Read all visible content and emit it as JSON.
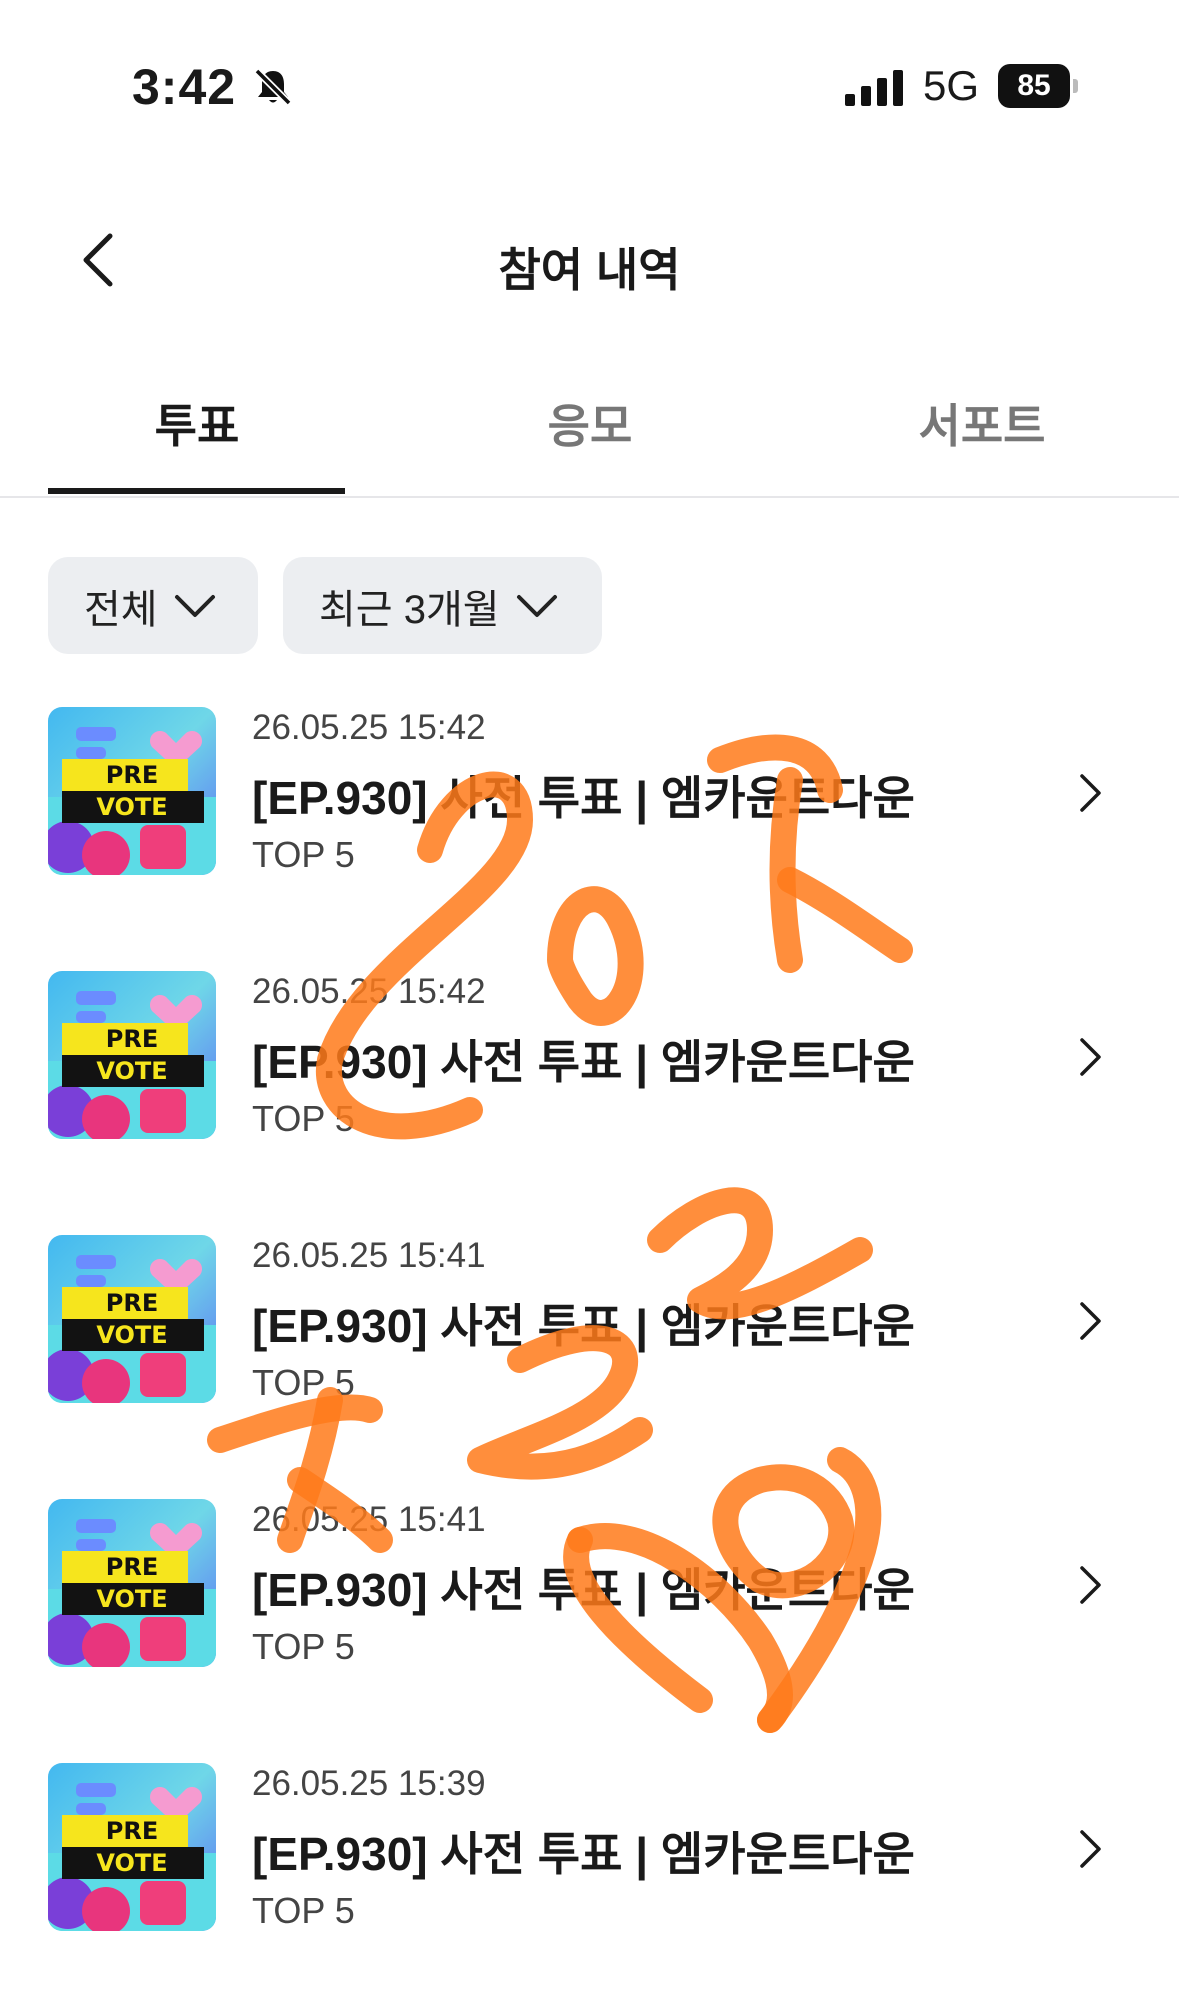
{
  "status_bar": {
    "time": "3:42",
    "network": "5G",
    "battery": "85"
  },
  "nav": {
    "title": "참여 내역"
  },
  "tabs": [
    {
      "label": "투표",
      "active": true
    },
    {
      "label": "응모",
      "active": false
    },
    {
      "label": "서포트",
      "active": false
    }
  ],
  "filters": {
    "category": "전체",
    "period": "최근 3개월"
  },
  "thumbnail": {
    "line1": "PRE",
    "line2": "VOTE"
  },
  "items": [
    {
      "date": "26.05.25 15:42",
      "title": "[EP.930] 사전 투표 | 엠카운트다운",
      "subtitle": "TOP 5"
    },
    {
      "date": "26.05.25 15:42",
      "title": "[EP.930] 사전 투표 | 엠카운트다운",
      "subtitle": "TOP 5"
    },
    {
      "date": "26.05.25 15:41",
      "title": "[EP.930] 사전 투표 | 엠카운트다운",
      "subtitle": "TOP 5"
    },
    {
      "date": "26.05.25 15:41",
      "title": "[EP.930] 사전 투표 | 엠카운트다운",
      "subtitle": "TOP 5"
    },
    {
      "date": "26.05.25 15:39",
      "title": "[EP.930] 사전 투표 | 엠카운트다운",
      "subtitle": "TOP 5"
    }
  ],
  "colors": {
    "scribble": "#ff7a1a",
    "chip_bg": "#eceef1"
  }
}
